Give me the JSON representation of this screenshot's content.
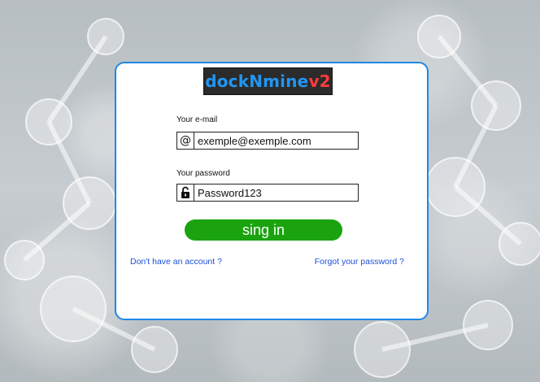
{
  "logo": {
    "text_part1": "dockNmine",
    "text_part2": "v2"
  },
  "email": {
    "label": "Your e-mail",
    "value": "exemple@exemple.com",
    "icon": "at-icon"
  },
  "password": {
    "label": "Your password",
    "value": "Password123",
    "icon": "lock-icon"
  },
  "buttons": {
    "signin_label": "sing in"
  },
  "links": {
    "signup": "Don't have an account ?",
    "forgot": "Forgot your password ?"
  },
  "colors": {
    "card_border": "#1e88e5",
    "signin_button": "#1aa30f",
    "link": "#1e4fd8",
    "logo_primary": "#2196f3",
    "logo_accent": "#ff3b3b"
  }
}
